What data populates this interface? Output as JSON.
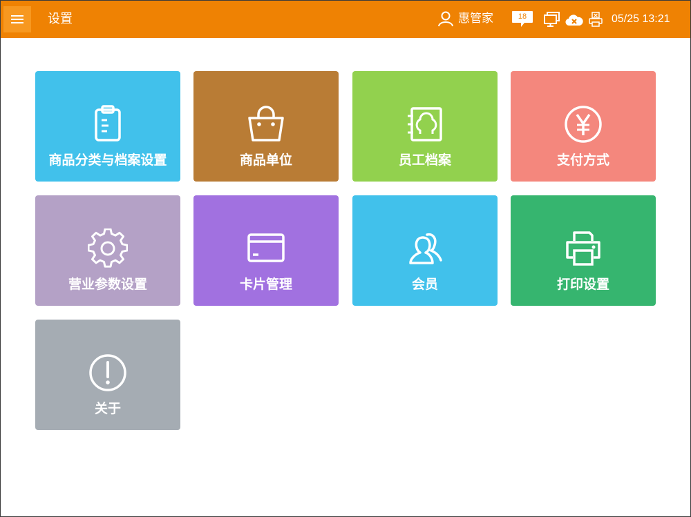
{
  "header": {
    "title": "设置",
    "user_name": "惠管家",
    "message_count": "18",
    "datetime": "05/25 13:21"
  },
  "colors": {
    "topbar": "#ef8203",
    "menu_button": "#f79820"
  },
  "icons": {
    "menu": "hamburger-menu-icon",
    "user": "user-icon",
    "messages": "message-icon",
    "monitor": "monitor-icon",
    "cloud": "cloud-disconnected-icon",
    "printer_status": "printer-status-icon"
  },
  "tiles": [
    {
      "label": "商品分类与档案设置",
      "icon": "clipboard-icon",
      "color": "#41c1eb"
    },
    {
      "label": "商品单位",
      "icon": "shopping-bag-icon",
      "color": "#b97c35"
    },
    {
      "label": "员工档案",
      "icon": "contact-book-icon",
      "color": "#92d14e"
    },
    {
      "label": "支付方式",
      "icon": "yen-icon",
      "color": "#f4877d"
    },
    {
      "label": "营业参数设置",
      "icon": "gear-icon",
      "color": "#b4a1c6"
    },
    {
      "label": "卡片管理",
      "icon": "card-icon",
      "color": "#a171e0"
    },
    {
      "label": "会员",
      "icon": "members-icon",
      "color": "#41c1eb"
    },
    {
      "label": "打印设置",
      "icon": "printer-icon",
      "color": "#36b56f"
    },
    {
      "label": "关于",
      "icon": "info-icon",
      "color": "#a5acb3"
    }
  ]
}
